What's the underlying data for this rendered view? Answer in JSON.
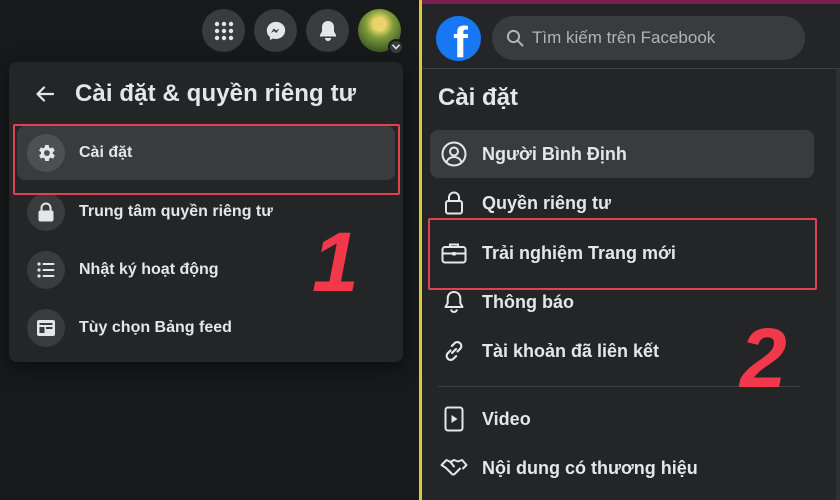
{
  "left_panel": {
    "title": "Cài đặt & quyền riêng tư",
    "menu": [
      {
        "label": "Cài đặt",
        "icon": "gear-icon",
        "active": true
      },
      {
        "label": "Trung tâm quyền riêng tư",
        "icon": "lock-icon"
      },
      {
        "label": "Nhật ký hoạt động",
        "icon": "list-icon"
      },
      {
        "label": "Tùy chọn Bảng feed",
        "icon": "feed-icon"
      }
    ],
    "step_marker": "1",
    "top_icons": [
      "apps-grid-icon",
      "messenger-icon",
      "bell-icon",
      "avatar"
    ]
  },
  "right_panel": {
    "search_placeholder": "Tìm kiếm trên Facebook",
    "section_title": "Cài đặt",
    "menu": [
      {
        "label": "Người Bình Định",
        "icon": "person-icon",
        "active": true
      },
      {
        "label": "Quyền riêng tư",
        "icon": "lock-icon"
      },
      {
        "label": "Trải nghiệm Trang mới",
        "icon": "briefcase-icon"
      },
      {
        "label": "Thông báo",
        "icon": "bell-icon"
      },
      {
        "label": "Tài khoản đã liên kết",
        "icon": "link-icon"
      },
      {
        "label": "Video",
        "icon": "video-icon"
      },
      {
        "label": "Nội dung có thương hiệu",
        "icon": "handshake-icon"
      }
    ],
    "step_marker": "2"
  },
  "colors": {
    "background": "#18191a",
    "panel": "#242526",
    "hover": "#3a3b3c",
    "text": "#e4e6eb",
    "highlight_box": "#e0434e",
    "step_number": "#f1394b",
    "facebook_blue": "#1877f2",
    "divider": "#d9cc32"
  }
}
